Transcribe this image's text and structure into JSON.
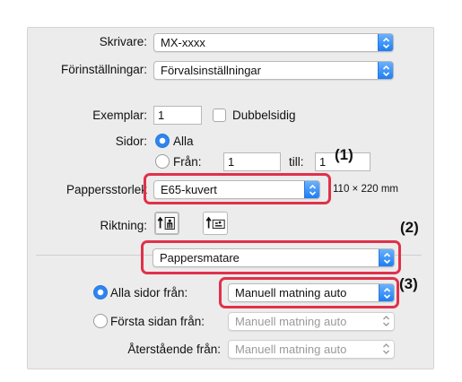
{
  "printer": {
    "label": "Skrivare:",
    "value": "MX-xxxx"
  },
  "presets": {
    "label": "Förinställningar:",
    "value": "Förvalsinställningar"
  },
  "copies": {
    "label": "Exemplar:",
    "value": "1",
    "duplex_label": "Dubbelsidig"
  },
  "pages": {
    "label": "Sidor:",
    "all_label": "Alla",
    "from_label": "Från:",
    "from_value": "1",
    "to_label": "till:",
    "to_value": "1"
  },
  "paper_size": {
    "label": "Pappersstorlek",
    "value": "E65-kuvert",
    "dimensions": "110 × 220 mm"
  },
  "orientation": {
    "label": "Riktning:"
  },
  "section": {
    "value": "Pappersmatare"
  },
  "feed": {
    "all_pages_label": "Alla sidor från:",
    "all_pages_value": "Manuell matning auto",
    "first_page_label": "Första sidan från:",
    "first_page_value": "Manuell matning auto",
    "remaining_label": "Återstående från:",
    "remaining_value": "Manuell matning auto"
  },
  "callouts": {
    "c1": "(1)",
    "c2": "(2)",
    "c3": "(3)"
  },
  "colors": {
    "highlight": "#e0314a",
    "accent": "#2d84f2"
  },
  "icons": {
    "popup": "chevron-updown-icon",
    "orient_portrait": "portrait-orientation-icon",
    "orient_landscape": "landscape-orientation-icon"
  }
}
